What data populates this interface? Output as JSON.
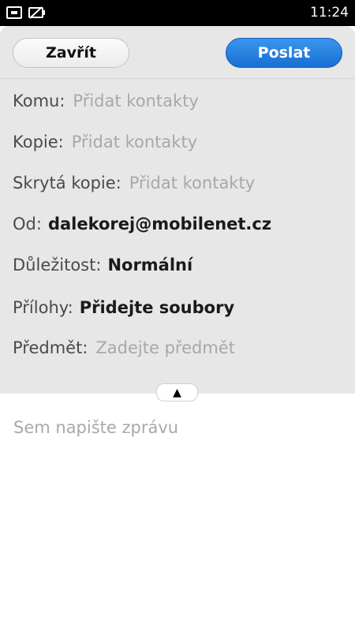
{
  "statusbar": {
    "time": "11:24",
    "icons": [
      "link-icon",
      "battery-icon"
    ]
  },
  "toolbar": {
    "close_label": "Zavřít",
    "send_label": "Poslat"
  },
  "fields": {
    "to": {
      "label": "Komu:",
      "placeholder": "Přidat kontakty"
    },
    "cc": {
      "label": "Kopie:",
      "placeholder": "Přidat kontakty"
    },
    "bcc": {
      "label": "Skrytá kopie:",
      "placeholder": "Přidat kontakty"
    },
    "from": {
      "label": "Od:",
      "value": "dalekorej@mobilenet.cz"
    },
    "priority": {
      "label": "Důležitost:",
      "value": "Normální"
    },
    "attachments": {
      "label": "Přílohy:",
      "value": "Přidejte soubory"
    },
    "subject": {
      "label": "Předmět:",
      "placeholder": "Zadejte předmět"
    }
  },
  "expand_tab": {
    "icon": "triangle-up-icon",
    "glyph": "▲"
  },
  "message": {
    "placeholder": "Sem napište zprávu"
  },
  "colors": {
    "send_button": "#1f7de0",
    "header_bg": "#e7e7e8",
    "placeholder": "#a8a8aa"
  }
}
